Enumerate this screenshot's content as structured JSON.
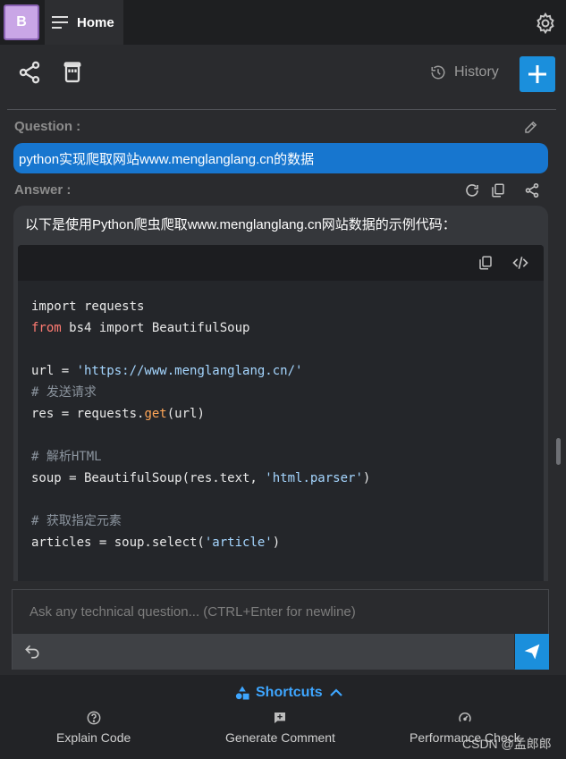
{
  "header": {
    "avatar_letter": "B",
    "home_label": "Home"
  },
  "toolbar": {
    "history_label": "History"
  },
  "question": {
    "label": "Question :",
    "text": "python实现爬取网站www.menglanglang.cn的数据"
  },
  "answer": {
    "label": "Answer :",
    "intro": "以下是使用Python爬虫爬取www.menglanglang.cn网站数据的示例代码："
  },
  "code": {
    "language": "python",
    "lines": [
      "import requests",
      "from bs4 import BeautifulSoup",
      "",
      "url = 'https://www.menglanglang.cn/'",
      "# 发送请求",
      "res = requests.get(url)",
      "",
      "# 解析HTML",
      "soup = BeautifulSoup(res.text, 'html.parser')",
      "",
      "# 获取指定元素",
      "articles = soup.select('article')"
    ]
  },
  "input": {
    "placeholder": "Ask any technical question... (CTRL+Enter for newline)"
  },
  "shortcuts": {
    "title": "Shortcuts",
    "items": [
      {
        "label": "Explain Code",
        "icon": "question-circle-icon"
      },
      {
        "label": "Generate Comment",
        "icon": "comment-plus-icon"
      },
      {
        "label": "Performance Check",
        "icon": "speedometer-icon"
      }
    ]
  },
  "watermark": "CSDN @孟郎郎",
  "colors": {
    "accent": "#1b8fdc",
    "question_bubble": "#1776cf",
    "link": "#3ea6ff"
  }
}
